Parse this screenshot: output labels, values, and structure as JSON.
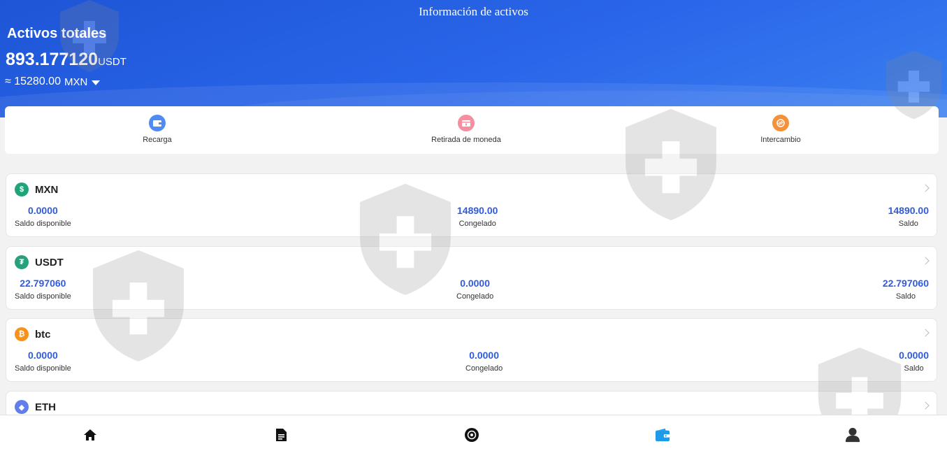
{
  "header": {
    "title": "Información de activos",
    "total_label": "Activos totales",
    "total_value": "893.177120",
    "total_unit": "USDT",
    "approx_prefix": "≈",
    "approx_value": "15280.00",
    "approx_currency": "MXN"
  },
  "actions": [
    {
      "label": "Recarga",
      "icon": "wallet-icon",
      "color": "#4f8af5"
    },
    {
      "label": "Retirada de moneda",
      "icon": "withdraw-icon",
      "color": "#f58f9f"
    },
    {
      "label": "Intercambio",
      "icon": "exchange-icon",
      "color": "#f5913b"
    }
  ],
  "assets": [
    {
      "name": "MXN",
      "icon": "dollar-icon",
      "icon_glyph": "$",
      "color": "#1fa37a",
      "available": "0.0000",
      "frozen": "14890.00",
      "balance": "14890.00"
    },
    {
      "name": "USDT",
      "icon": "tether-icon",
      "icon_glyph": "₮",
      "color": "#26a17b",
      "available": "22.797060",
      "frozen": "0.0000",
      "balance": "22.797060"
    },
    {
      "name": "btc",
      "icon": "bitcoin-icon",
      "icon_glyph": "₿",
      "color": "#f7931a",
      "available": "0.0000",
      "frozen": "0.0000",
      "balance": "0.0000"
    },
    {
      "name": "ETH",
      "icon": "ethereum-icon",
      "icon_glyph": "◆",
      "color": "#627eea"
    }
  ],
  "labels": {
    "available": "Saldo disponible",
    "frozen": "Congelado",
    "balance": "Saldo"
  },
  "tabbar": [
    {
      "icon": "home-icon",
      "active": false
    },
    {
      "icon": "document-icon",
      "active": false
    },
    {
      "icon": "market-icon",
      "active": false
    },
    {
      "icon": "wallet-icon",
      "active": true,
      "color": "#1e9be8"
    },
    {
      "icon": "user-icon",
      "active": false
    }
  ]
}
